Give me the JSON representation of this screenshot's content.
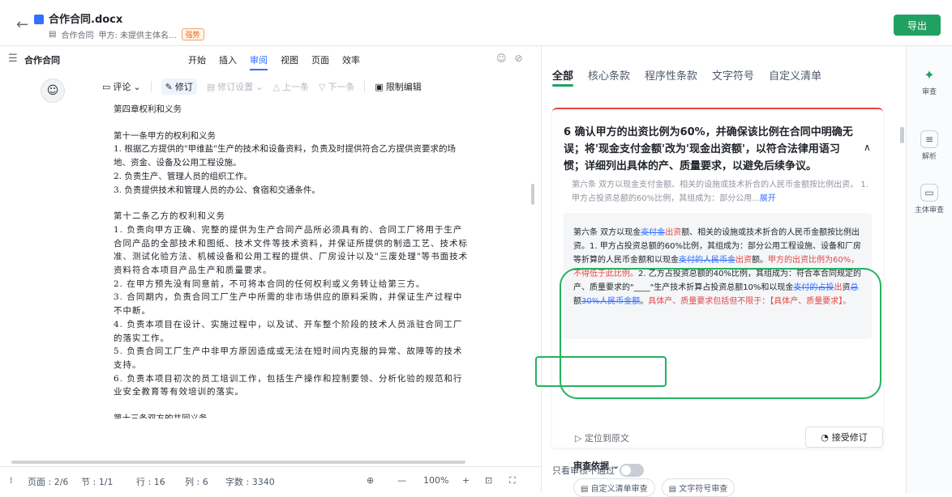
{
  "header": {
    "title": "合作合同.docx",
    "subtitle_doc": "合作合同",
    "subtitle_party": "甲方: 未提供主体名...",
    "tag": "强势",
    "export_label": "导出"
  },
  "editor": {
    "doc_name": "合作合同",
    "menus": [
      "开始",
      "插入",
      "审阅",
      "视图",
      "页面",
      "效率"
    ],
    "active_menu": "审阅",
    "toolbar": {
      "comment": "评论",
      "track": "修订",
      "track_settings": "修订设置",
      "prev": "上一条",
      "next": "下一条",
      "restrict": "限制编辑"
    },
    "paragraphs": [
      "第四章权利和义务",
      "",
      "第十一条甲方的权利和义务",
      "1. 根据乙方提供的\"甲维盐\"生产的技术和设备资料，负责及时提供符合乙方提供资要求的场地、资金、设备及公用工程设施。",
      "2. 负责生产、管理人员的组织工作。",
      "3. 负责提供技术和管理人员的办公、食宿和交通条件。",
      "",
      "第十二条乙方的权利和义务",
      "1. 负责向甲方正确、完整的提供为生产合同产品所必须具有的、合同工厂将用于生产合同产品的全部技术和图纸、技术文件等技术资料，并保证所提供的制造工艺、技术标准、测试化验方法、机械设备和公用工程的提供、厂房设计以及\"三废处理\"等书面技术资料符合本项目产品生产和质量要求。",
      "2. 在甲方预先没有同意前，不可将本合同的任何权利或义务转让给第三方。",
      "3. 合同期内，负责合同工厂生产中所需的非市场供应的原料采购，并保证生产过程中不中断。",
      "4. 负责本项目在设计、实施过程中，以及试、开车整个阶段的技术人员派驻合同工厂的落实工作。",
      "5. 负责合同工厂生产中非甲方原因造成或无法在短时间内克服的异常、故障等的技术支持。",
      "6. 负责本项目初次的员工培训工作，包括生产操作和控制要领、分析化验的规范和行业安全教育等有效培训的落实。",
      "",
      "第十三条双方的共同义务"
    ]
  },
  "statusbar": {
    "page": "页面 : 2/6",
    "section": "节 : 1/1",
    "row": "行 : 16",
    "col": "列 : 6",
    "words": "字数 : 3340",
    "zoom": "100%"
  },
  "review": {
    "tabs": [
      "全部",
      "核心条款",
      "程序性条款",
      "文字符号",
      "自定义清单"
    ],
    "active_tab": "全部",
    "card_title": "6 确认甲方的出资比例为60%，并确保该比例在合同中明确无误；将'现金支付金额'改为'现金出资额'，以符合法律用语习惯；详细列出具体的产、质量要求，以避免后续争议。",
    "original_text": "第六条 双方以现金支付金额、相关的设施或技术折合的人民币金额按比例出资。 1. 甲方占投资总额的60%比例，其组成为：部分公用...",
    "expand_label": "展开",
    "revised": {
      "p1": "第六条 双方以现金",
      "d1": "支付金",
      "i1": "出资",
      "p2": "额、相关的设施或技术折合的人民币金额按比例出资。1. 甲方占投资总额的60%比例，其组成为：部分公用工程设施、设备和厂房等折算的人民币金额和以现金",
      "d2": "支付的人民币金",
      "i2": "出资",
      "p3": "额。",
      "i3": "甲方的出资比例为60%，不得低于此比例。",
      "p4": "2. 乙方占投资总额的40%比例，其组成为：符合本合同规定的产、质量要求的\"____\"生产技术折算占投资总额10%和以现金",
      "d3": "支付的占投",
      "i4": "出",
      "p5": "资",
      "d4": "总",
      "p6": "额",
      "d5": "30%人民币金额",
      "p7": "。",
      "i5": "具体产、质量要求包括但不限于：【具体产、质量要求】。"
    },
    "locate_label": "定位到原文",
    "accept_label": "接受修订",
    "basis_label": "审查依据",
    "chips": [
      "自定义清单审查",
      "文字符号审查"
    ],
    "only_failed_label": "只看审核不通过"
  },
  "sidebar": {
    "items": [
      "审查",
      "解析",
      "主体审查"
    ]
  },
  "colors": {
    "accent_green": "#20a161",
    "link_blue": "#3370ff",
    "insert_red": "#e54545"
  }
}
